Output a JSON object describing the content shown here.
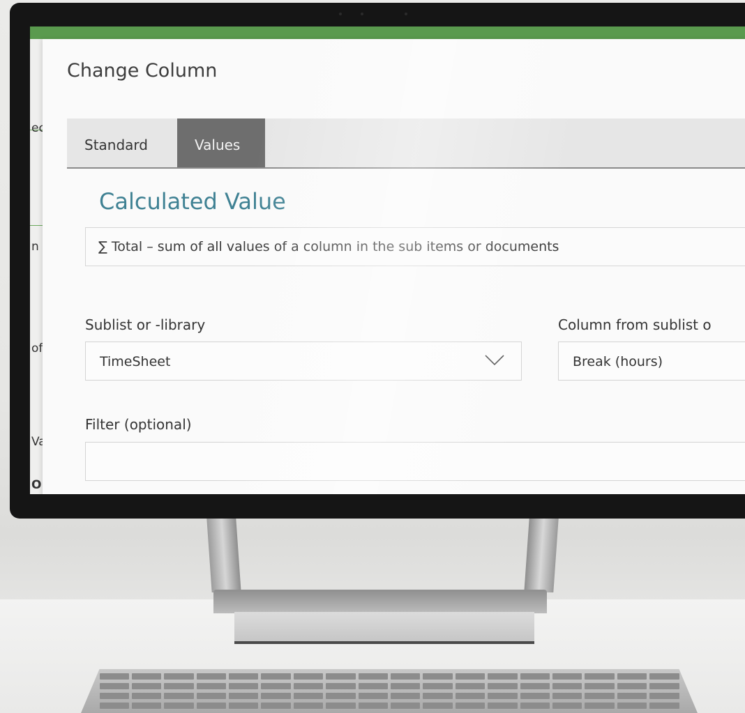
{
  "background_app": {
    "fragments": [
      "ec",
      "n",
      "of",
      "Va",
      "OU"
    ]
  },
  "dialog": {
    "title": "Change Column",
    "tabs": [
      {
        "label": "Standard",
        "selected": false
      },
      {
        "label": "Values",
        "selected": true
      }
    ],
    "section_heading": "Calculated Value",
    "calculation_type": "∑ Total – sum of all values of a column in the sub items or documents",
    "fields": {
      "sublist": {
        "label": "Sublist or -library",
        "value": "TimeSheet"
      },
      "column": {
        "label": "Column from sublist o",
        "value": "Break (hours)"
      },
      "filter": {
        "label": "Filter (optional)",
        "value": ""
      }
    }
  },
  "colors": {
    "accent_heading": "#3f8193",
    "selected_tab": "#6e6e6e",
    "app_green": "#5a9a4e"
  },
  "icons": {
    "dropdown": "chevron-down-icon"
  }
}
